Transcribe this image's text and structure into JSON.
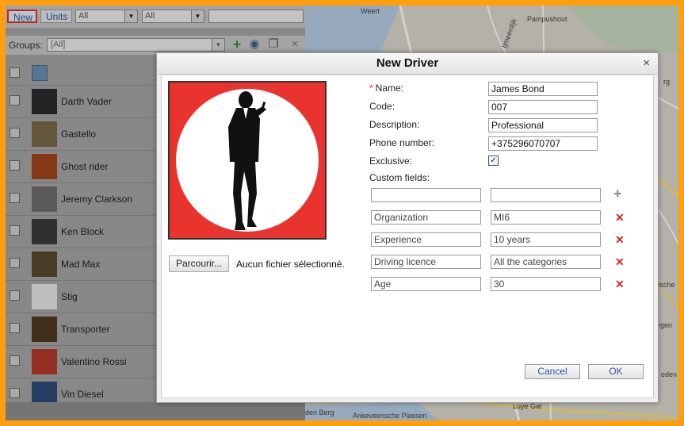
{
  "toolbar": {
    "new_label": "New",
    "units_label": "Units",
    "filter1_value": "All",
    "filter2_value": "All",
    "search_value": ""
  },
  "groups": {
    "label": "Groups:",
    "selected": "[All]",
    "icons": [
      "add-icon",
      "eye-icon",
      "copy-icon",
      "close-icon"
    ]
  },
  "drivers": [
    {
      "name": "Darth Vader",
      "thumb_color": "#2b2b2b"
    },
    {
      "name": "Gastello",
      "thumb_color": "#7b6a4a"
    },
    {
      "name": "Ghost rider",
      "thumb_color": "#a3461c"
    },
    {
      "name": "Jeremy Clarkson",
      "thumb_color": "#6e6e6e"
    },
    {
      "name": "Ken Block",
      "thumb_color": "#3a3a3a"
    },
    {
      "name": "Mad Max",
      "thumb_color": "#5a4a2e"
    },
    {
      "name": "Stig",
      "thumb_color": "#e8e8e8"
    },
    {
      "name": "Transporter",
      "thumb_color": "#4e3a22"
    },
    {
      "name": "Valentino Rossi",
      "thumb_color": "#b5392a"
    },
    {
      "name": "Vin Diesel",
      "thumb_color": "#2f4b7a"
    }
  ],
  "map": {
    "labels": [
      {
        "text": "Weert"
      },
      {
        "text": "Pampushout"
      },
      {
        "text": "Ijmeerdijk"
      },
      {
        "text": "Luye Gat"
      },
      {
        "text": "Ankeveensche Plassen"
      },
      {
        "text": "den Berg"
      },
      {
        "text": "rgen"
      },
      {
        "text": "tische"
      },
      {
        "text": "eden"
      },
      {
        "text": "rg"
      }
    ]
  },
  "dialog": {
    "title": "New Driver",
    "close_glyph": "×",
    "browse_label": "Parcourir...",
    "file_status": "Aucun fichier sélectionné.",
    "name_label": "Name:",
    "name_required_mark": "*",
    "name_value": "James Bond",
    "code_label": "Code:",
    "code_value": "007",
    "description_label": "Description:",
    "description_value": "Professional",
    "phone_label": "Phone number:",
    "phone_value": "+375296070707",
    "exclusive_label": "Exclusive:",
    "exclusive_checked": true,
    "custom_fields_label": "Custom fields:",
    "new_field_name": "",
    "new_field_value": "",
    "custom_fields": [
      {
        "name": "Organization",
        "value": "MI6"
      },
      {
        "name": "Experience",
        "value": "10 years"
      },
      {
        "name": "Driving licence",
        "value": "All the categories"
      },
      {
        "name": "Age",
        "value": "30"
      }
    ],
    "cancel_label": "Cancel",
    "ok_label": "OK"
  }
}
